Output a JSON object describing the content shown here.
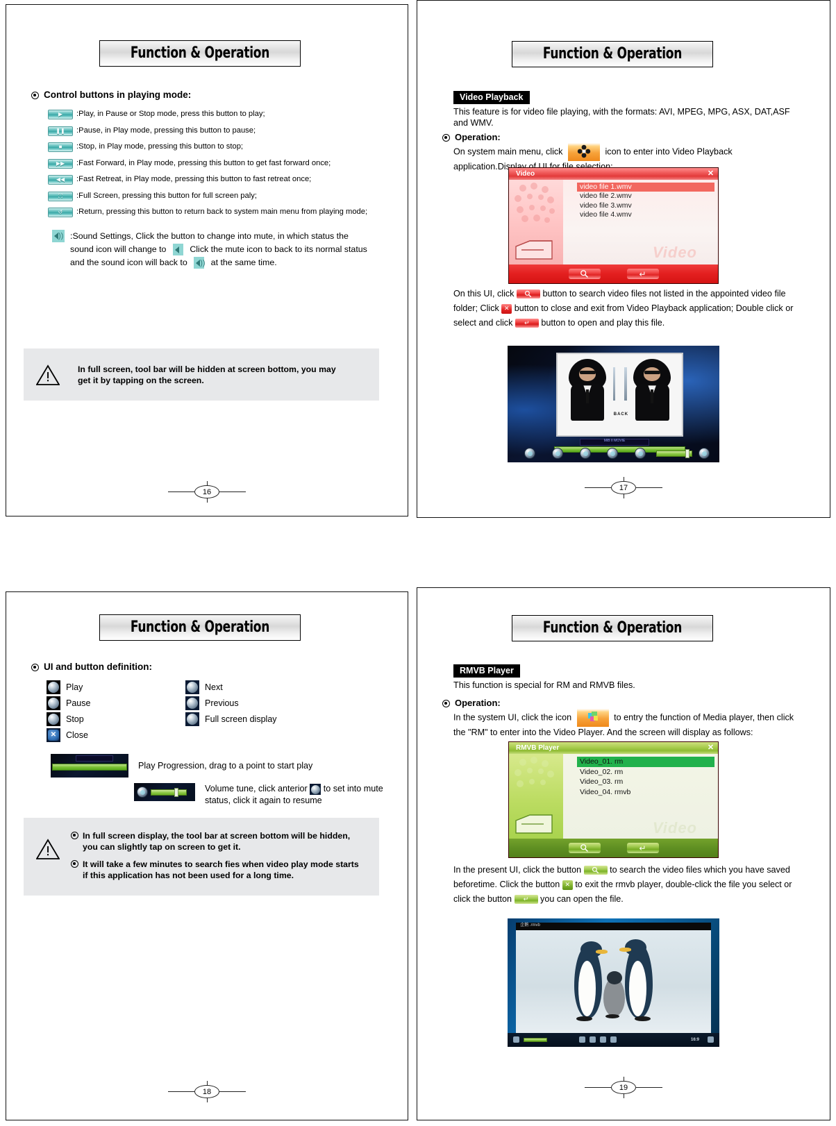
{
  "document": {
    "title": "Function & Operation",
    "pages": [
      {
        "number": "16",
        "heading": "Function & Operation",
        "section_heading": "Control buttons in playing mode:",
        "buttons": [
          {
            "icon": "play-icon",
            "glyph": "▶",
            "text": ":Play, in Pause or Stop mode, press this button to play;"
          },
          {
            "icon": "pause-icon",
            "glyph": "❚❚",
            "text": ":Pause, in Play mode, pressing this button to pause;"
          },
          {
            "icon": "stop-icon",
            "glyph": "■",
            "text": ":Stop, in Play mode, pressing this button to stop;"
          },
          {
            "icon": "fast-forward-icon",
            "glyph": "▶▶",
            "text": ":Fast Forward, in Play mode, pressing this button to get fast forward once;"
          },
          {
            "icon": "fast-retreat-icon",
            "glyph": "◀◀",
            "text": ":Fast Retreat, in Play mode, pressing this button to fast retreat once;"
          },
          {
            "icon": "full-screen-icon",
            "glyph": "⛶",
            "text": ":Full Screen, pressing this button for full screen paly;"
          },
          {
            "icon": "return-icon",
            "glyph": "↺",
            "text": ":Return, pressing this button to return back to system main menu from playing mode;"
          }
        ],
        "sound": {
          "part1": ":Sound Settings, Click the button to change into mute, in which status the sound icon will change to",
          "part2": "Click the mute icon to back to its normal status and the sound icon will back to",
          "part3": "at the same time."
        },
        "warning": "In full screen, tool bar will be hidden at screen bottom, you may get it by tapping on the screen."
      },
      {
        "number": "17",
        "heading": "Function & Operation",
        "section_label": "Video Playback",
        "intro": "This feature is for video file playing, with the formats: AVI, MPEG, MPG, ASX, DAT,ASF and WMV.",
        "operation_label": "Operation:",
        "operation_pre": "On system main menu, click",
        "operation_post": "icon to enter into Video Playback application.Display of UI for file selection:",
        "dialog": {
          "title": "Video",
          "close_label": "✕",
          "watermark": "Video",
          "files": [
            "video file 1.wmv",
            "video file 2.wmv",
            "video file 3.wmv",
            "video file 4.wmv"
          ],
          "selected_index": 0,
          "search_glyph": "🔍",
          "enter_glyph": "↵",
          "accent": "#e32222"
        },
        "desc": {
          "p1": "On this UI, click",
          "p2": "button to search video files not listed in the appointed video file folder; Click",
          "p3": "button to close and exit from Video Playback application; Double click or select and click",
          "p4": "button to open and play this file."
        },
        "player": {
          "caption": "BACK",
          "osd_text": "MIB II  MOVIE"
        }
      },
      {
        "number": "18",
        "heading": "Function & Operation",
        "section_heading": "UI and button definition:",
        "buttons_left": [
          {
            "icon": "play-orb-icon",
            "label": "Play"
          },
          {
            "icon": "pause-orb-icon",
            "label": "Pause"
          },
          {
            "icon": "stop-orb-icon",
            "label": "Stop"
          },
          {
            "icon": "close-orb-icon",
            "label": "Close"
          }
        ],
        "buttons_right": [
          {
            "icon": "next-orb-icon",
            "label": "Next"
          },
          {
            "icon": "previous-orb-icon",
            "label": "Previous"
          },
          {
            "icon": "fullscreen-orb-icon",
            "label": "Full screen display"
          }
        ],
        "progression_text": "Play Progression, drag to a point to start play",
        "volume_text_1": "Volume tune, click anterior",
        "volume_text_2": "to set into mute status, click it again to resume",
        "warnings": [
          "In full screen display, the tool bar at screen bottom will be hidden, you can slightly tap on screen to get it.",
          "It will take a few minutes to search fies when video play mode starts if this application has not been used for a long time."
        ]
      },
      {
        "number": "19",
        "heading": "Function & Operation",
        "section_label": "RMVB Player",
        "intro": "This function is special for RM and RMVB files.",
        "operation_label": "Operation:",
        "operation_pre": "In the system UI, click the icon",
        "operation_post": "to entry the function of Media player, then click the \"RM\" to enter into the Video Player. And the screen will display as follows:",
        "dialog": {
          "title": "RMVB Player",
          "close_label": "✕",
          "watermark": "Video",
          "files": [
            "Video_01. rm",
            "Video_02. rm",
            "Video_03. rm",
            "Video_04. rmvb"
          ],
          "selected_index": 0,
          "search_glyph": "🔍",
          "enter_glyph": "↵",
          "accent": "#5f8f22"
        },
        "desc": {
          "p1": "In the present UI, click the button",
          "p2": "to search the video files which you have saved beforetime. Click the button",
          "p3": "to exit the rmvb player, double-click the file you select or click the button",
          "p4": "you can open the file."
        },
        "player": {
          "title_text": "企鹅 .rmvb",
          "ratio": "16:9"
        }
      }
    ]
  }
}
